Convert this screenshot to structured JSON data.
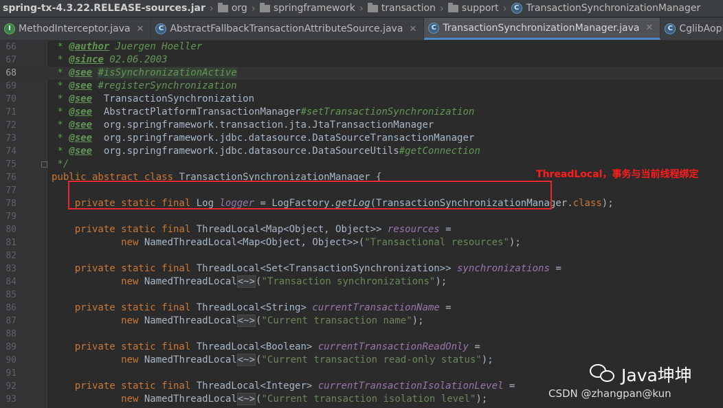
{
  "breadcrumb": [
    {
      "label": "spring-tx-4.3.22.RELEASE-sources.jar",
      "icon": "jar-icon"
    },
    {
      "label": "org",
      "icon": "folder-icon"
    },
    {
      "label": "springframework",
      "icon": "folder-icon"
    },
    {
      "label": "transaction",
      "icon": "folder-icon"
    },
    {
      "label": "support",
      "icon": "folder-icon"
    },
    {
      "label": "TransactionSynchronizationManager",
      "icon": "class-icon"
    }
  ],
  "tabs": [
    {
      "label": "MethodInterceptor.java",
      "kind": "interface",
      "active": false
    },
    {
      "label": "AbstractFallbackTransactionAttributeSource.java",
      "kind": "class",
      "active": false
    },
    {
      "label": "TransactionSynchronizationManager.java",
      "kind": "class",
      "active": true
    },
    {
      "label": "CglibAopPro",
      "kind": "class",
      "active": false
    }
  ],
  "lines": [
    {
      "n": "66",
      "tokens": [
        [
          "t-doc",
          " * "
        ],
        [
          "t-tag",
          "@author"
        ],
        [
          "t-doc",
          " Juergen Hoeller"
        ]
      ]
    },
    {
      "n": "67",
      "tokens": [
        [
          "t-doc",
          " * "
        ],
        [
          "t-tag",
          "@since"
        ],
        [
          "t-doc",
          " 02.06.2003"
        ]
      ]
    },
    {
      "n": "68",
      "current": true,
      "tokens": [
        [
          "t-doc",
          " * "
        ],
        [
          "t-tag",
          "@see"
        ],
        [
          "t-doc",
          " "
        ],
        [
          "t-doc t-hl",
          "#isSynchronizationActive"
        ]
      ]
    },
    {
      "n": "69",
      "tokens": [
        [
          "t-doc",
          " * "
        ],
        [
          "t-tag",
          "@see"
        ],
        [
          "t-doc",
          " #registerSynchronization"
        ]
      ]
    },
    {
      "n": "70",
      "tokens": [
        [
          "t-doc",
          " * "
        ],
        [
          "t-tag",
          "@see"
        ],
        [
          "",
          "  TransactionSynchronization"
        ]
      ]
    },
    {
      "n": "71",
      "tokens": [
        [
          "t-doc",
          " * "
        ],
        [
          "t-tag",
          "@see"
        ],
        [
          "",
          "  AbstractPlatformTransactionManager"
        ],
        [
          "t-doc",
          "#setTransactionSynchronization"
        ]
      ]
    },
    {
      "n": "72",
      "tokens": [
        [
          "t-doc",
          " * "
        ],
        [
          "t-tag",
          "@see"
        ],
        [
          "",
          "  org.springframework.transaction.jta.JtaTransactionManager"
        ]
      ]
    },
    {
      "n": "73",
      "tokens": [
        [
          "t-doc",
          " * "
        ],
        [
          "t-tag",
          "@see"
        ],
        [
          "",
          "  org.springframework.jdbc.datasource.DataSourceTransactionManager"
        ]
      ]
    },
    {
      "n": "74",
      "tokens": [
        [
          "t-doc",
          " * "
        ],
        [
          "t-tag",
          "@see"
        ],
        [
          "",
          "  org.springframework.jdbc.datasource.DataSourceUtils"
        ],
        [
          "t-doc",
          "#getConnection"
        ]
      ]
    },
    {
      "n": "75",
      "fold": true,
      "tokens": [
        [
          "t-doc",
          " */"
        ]
      ]
    },
    {
      "n": "76",
      "tokens": [
        [
          "t-kw",
          "public abstract class"
        ],
        [
          "",
          " TransactionSynchronizationManager {"
        ]
      ]
    },
    {
      "n": "77",
      "tokens": []
    },
    {
      "n": "78",
      "tokens": [
        [
          "",
          "    "
        ],
        [
          "t-kw",
          "private static final"
        ],
        [
          "",
          " Log "
        ],
        [
          "t-fld",
          "logger"
        ],
        [
          "",
          " = LogFactory."
        ],
        [
          "t-fn",
          "getLog"
        ],
        [
          "",
          "(TransactionSynchronizationManager."
        ],
        [
          "t-kw",
          "class"
        ],
        [
          "",
          ");"
        ]
      ]
    },
    {
      "n": "79",
      "tokens": []
    },
    {
      "n": "80",
      "tokens": [
        [
          "",
          "    "
        ],
        [
          "t-kw",
          "private static final"
        ],
        [
          "",
          " ThreadLocal<Map<Object, Object>> "
        ],
        [
          "t-fld",
          "resources"
        ],
        [
          "",
          " ="
        ]
      ]
    },
    {
      "n": "81",
      "tokens": [
        [
          "",
          "            "
        ],
        [
          "t-kw",
          "new"
        ],
        [
          "",
          " NamedThreadLocal<Map<Object, Object>>("
        ],
        [
          "t-str",
          "\"Transactional resources\""
        ],
        [
          "",
          ");"
        ]
      ]
    },
    {
      "n": "82",
      "tokens": []
    },
    {
      "n": "83",
      "tokens": [
        [
          "",
          "    "
        ],
        [
          "t-kw",
          "private static final"
        ],
        [
          "",
          " ThreadLocal<Set<TransactionSynchronization>> "
        ],
        [
          "t-fld",
          "synchronizations"
        ],
        [
          "",
          " ="
        ]
      ]
    },
    {
      "n": "84",
      "tokens": [
        [
          "",
          "            "
        ],
        [
          "t-kw",
          "new"
        ],
        [
          "",
          " NamedThreadLocal"
        ],
        [
          "t-fold",
          "<~>"
        ],
        [
          "",
          "("
        ],
        [
          "t-str",
          "\"Transaction synchronizations\""
        ],
        [
          "",
          ");"
        ]
      ]
    },
    {
      "n": "85",
      "tokens": []
    },
    {
      "n": "86",
      "tokens": [
        [
          "",
          "    "
        ],
        [
          "t-kw",
          "private static final"
        ],
        [
          "",
          " ThreadLocal<String> "
        ],
        [
          "t-fld",
          "currentTransactionName"
        ],
        [
          "",
          " ="
        ]
      ]
    },
    {
      "n": "87",
      "tokens": [
        [
          "",
          "            "
        ],
        [
          "t-kw",
          "new"
        ],
        [
          "",
          " NamedThreadLocal"
        ],
        [
          "t-fold",
          "<~>"
        ],
        [
          "",
          "("
        ],
        [
          "t-str",
          "\"Current transaction name\""
        ],
        [
          "",
          ");"
        ]
      ]
    },
    {
      "n": "88",
      "tokens": []
    },
    {
      "n": "89",
      "tokens": [
        [
          "",
          "    "
        ],
        [
          "t-kw",
          "private static final"
        ],
        [
          "",
          " ThreadLocal<Boolean> "
        ],
        [
          "t-fld",
          "currentTransactionReadOnly"
        ],
        [
          "",
          " ="
        ]
      ]
    },
    {
      "n": "90",
      "tokens": [
        [
          "",
          "            "
        ],
        [
          "t-kw",
          "new"
        ],
        [
          "",
          " NamedThreadLocal"
        ],
        [
          "t-fold",
          "<~>"
        ],
        [
          "",
          "("
        ],
        [
          "t-str",
          "\"Current transaction read-only status\""
        ],
        [
          "",
          ");"
        ]
      ]
    },
    {
      "n": "91",
      "tokens": []
    },
    {
      "n": "92",
      "tokens": [
        [
          "",
          "    "
        ],
        [
          "t-kw",
          "private static final"
        ],
        [
          "",
          " ThreadLocal<Integer> "
        ],
        [
          "t-fld",
          "currentTransactionIsolationLevel"
        ],
        [
          "",
          " ="
        ]
      ]
    },
    {
      "n": "93",
      "tokens": [
        [
          "",
          "            "
        ],
        [
          "t-kw",
          "new"
        ],
        [
          "",
          " NamedThreadLocal"
        ],
        [
          "t-fold",
          "<~>"
        ],
        [
          "",
          "("
        ],
        [
          "t-str",
          "\"Current transaction isolation level\""
        ],
        [
          "",
          ");"
        ]
      ]
    }
  ],
  "annotation": {
    "text": "ThreadLocal，事务与当前线程绑定",
    "color": "#ff1c1c"
  },
  "watermark": {
    "label": "Java坤坤",
    "icon": "wechat-icon"
  },
  "csdn_credit": "CSDN @zhangpan@kun"
}
